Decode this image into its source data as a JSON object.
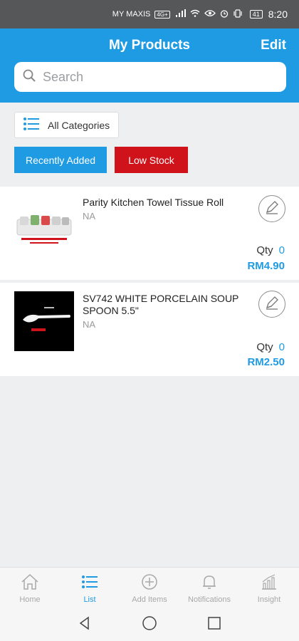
{
  "status_bar": {
    "carrier": "MY MAXIS",
    "network": "4G+",
    "battery": "41",
    "time": "8:20"
  },
  "header": {
    "title": "My Products",
    "edit_label": "Edit"
  },
  "search": {
    "placeholder": "Search"
  },
  "categories_label": "All Categories",
  "filters": {
    "recent": "Recently Added",
    "low_stock": "Low Stock"
  },
  "products": [
    {
      "name": "Parity Kitchen Towel Tissue Roll",
      "sku": "NA",
      "qty_label": "Qty",
      "qty": "0",
      "price": "RM4.90"
    },
    {
      "name": "SV742  WHITE PORCELAIN SOUP SPOON 5.5\"",
      "sku": "NA",
      "qty_label": "Qty",
      "qty": "0",
      "price": "RM2.50"
    }
  ],
  "tabs": [
    {
      "label": "Home",
      "icon": "home-icon"
    },
    {
      "label": "List",
      "icon": "list-icon"
    },
    {
      "label": "Add Items",
      "icon": "plus-circle-icon"
    },
    {
      "label": "Notifications",
      "icon": "bell-icon"
    },
    {
      "label": "Insight",
      "icon": "chart-icon"
    }
  ],
  "active_tab": "List",
  "colors": {
    "accent": "#1e9be3",
    "danger": "#d0121b"
  }
}
